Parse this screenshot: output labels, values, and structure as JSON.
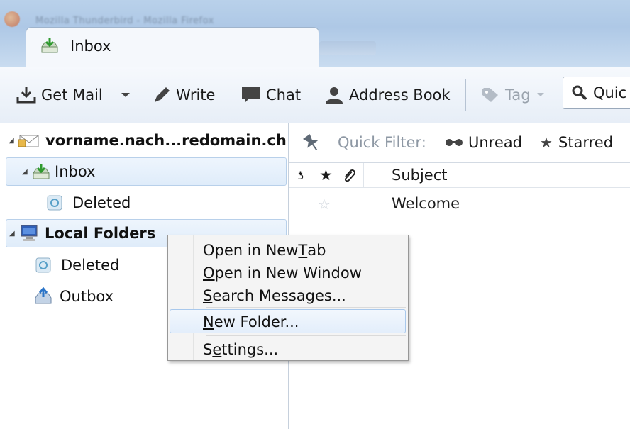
{
  "window": {
    "title": "Mozilla Thunderbird - Mozilla Firefox"
  },
  "tabs": [
    {
      "label": "Inbox",
      "icon": "inbox-download-icon"
    }
  ],
  "toolbar": {
    "get_mail": "Get Mail",
    "write": "Write",
    "chat": "Chat",
    "address_book": "Address Book",
    "tag": "Tag",
    "quick_search": "Quic"
  },
  "folders": {
    "account": "vorname.nach...redomain.ch",
    "inbox": "Inbox",
    "account_deleted": "Deleted",
    "local_folders": "Local Folders",
    "local_deleted": "Deleted",
    "outbox": "Outbox"
  },
  "quick_filter": {
    "label": "Quick Filter:",
    "unread": "Unread",
    "starred": "Starred"
  },
  "columns": {
    "subject": "Subject"
  },
  "messages": [
    {
      "subject": "Welcome",
      "starred": false
    }
  ],
  "context_menu": {
    "items": [
      {
        "label": "Open in New Tab",
        "access_key": "T"
      },
      {
        "label": "Open in New Window",
        "access_key": "O"
      },
      {
        "label": "Search Messages...",
        "access_key": "S"
      },
      {
        "label": "New Folder...",
        "access_key": "N",
        "highlighted": true
      },
      {
        "label": "Settings...",
        "access_key": "e"
      }
    ]
  },
  "colors": {
    "titlebar": "#b9d1ea",
    "selection": "#dfecfa",
    "menu_bg": "#f4f4f4"
  }
}
